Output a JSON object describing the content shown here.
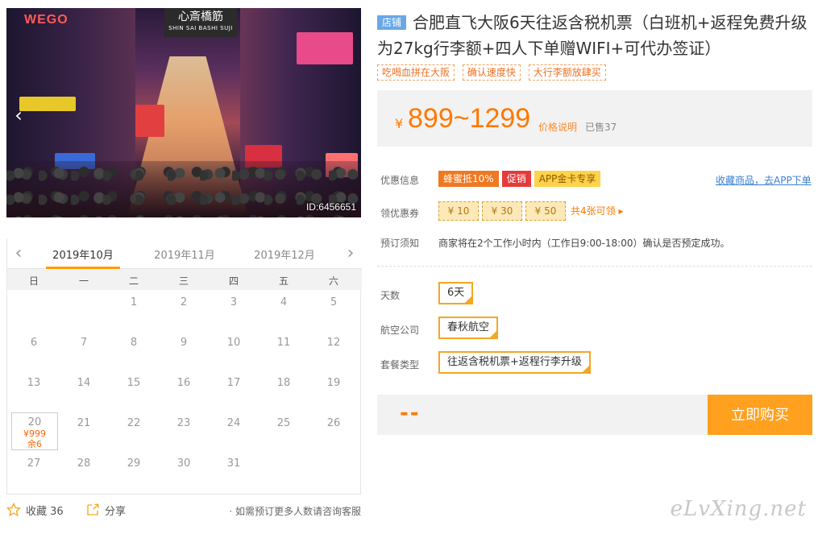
{
  "photo": {
    "logo_text": "WEGO",
    "shop_sign": "心斎橋筋",
    "shop_sign_sub": "SHIN SAI BASHI SUJI",
    "id_label": "ID:6456651"
  },
  "calendar": {
    "months": [
      "2019年10月",
      "2019年11月",
      "2019年12月"
    ],
    "weekdays": [
      "日",
      "一",
      "二",
      "三",
      "四",
      "五",
      "六"
    ],
    "days": [
      "1",
      "2",
      "3",
      "4",
      "5",
      "6",
      "7",
      "8",
      "9",
      "10",
      "11",
      "12",
      "13",
      "14",
      "15",
      "16",
      "17",
      "18",
      "19",
      "20",
      "21",
      "22",
      "23",
      "24",
      "25",
      "26",
      "27",
      "28",
      "29",
      "30",
      "31"
    ],
    "selected_price": "¥999",
    "selected_stock": "余6"
  },
  "bottom": {
    "fav_label": "收藏 36",
    "share_label": "分享",
    "note": "· 如需预订更多人数请咨询客服"
  },
  "product": {
    "shop_badge": "店铺",
    "title": "合肥直飞大阪6天往返含税机票（白班机+返程免费升级为27kg行李额+四人下单赠WIFI+可代办签证）",
    "tags": [
      "吃喝血拼在大阪",
      "确认速度快",
      "大行李额放肆买"
    ],
    "price_symbol": "¥",
    "price": "899~1299",
    "price_explain": "价格说明",
    "sold": "已售37"
  },
  "promo": {
    "label": "优惠信息",
    "badges": [
      "蜂蜜抵10%",
      "促销",
      "APP金卡专享"
    ],
    "fav_link": "收藏商品，去APP下单"
  },
  "coupons": {
    "label": "领优惠券",
    "items": [
      "¥ 10",
      "¥ 30",
      "¥ 50"
    ],
    "more": "共4张可领 ▸"
  },
  "notice": {
    "label": "预订须知",
    "text": "商家将在2个工作小时内（工作日9:00-18:00）确认是否预定成功。"
  },
  "options": {
    "days_label": "天数",
    "days_value": "6天",
    "airline_label": "航空公司",
    "airline_value": "春秋航空",
    "package_label": "套餐类型",
    "package_value": "往返含税机票+返程行李升级"
  },
  "buy": {
    "price_placeholder": "--",
    "button": "立即购买"
  },
  "watermark": "eLvXing.net",
  "colors": {
    "accent": "#ff7800",
    "button": "#ffa01e",
    "link": "#3a7fd0"
  }
}
